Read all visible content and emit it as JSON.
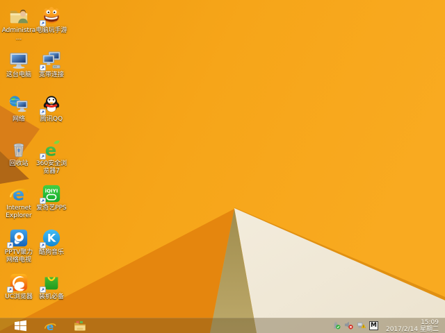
{
  "desktop": {
    "icons": [
      {
        "name": "administrator-folder",
        "label": "Administra...",
        "shortcut": false
      },
      {
        "name": "pc-play-mobile-games",
        "label": "电脑玩手游",
        "shortcut": true
      },
      {
        "name": "this-pc",
        "label": "这台电脑",
        "shortcut": false
      },
      {
        "name": "broadband-connection",
        "label": "宽带连接",
        "shortcut": true
      },
      {
        "name": "network",
        "label": "网络",
        "shortcut": false
      },
      {
        "name": "tencent-qq",
        "label": "腾讯QQ",
        "shortcut": true
      },
      {
        "name": "recycle-bin",
        "label": "回收站",
        "shortcut": false
      },
      {
        "name": "360-safe-browser-7",
        "label": "360安全浏览器7",
        "shortcut": true
      },
      {
        "name": "internet-explorer",
        "label": "Internet Explorer",
        "shortcut": false
      },
      {
        "name": "iqiyi-pps",
        "label": "爱奇艺PPS",
        "shortcut": true
      },
      {
        "name": "pptv-nettv",
        "label": "PPTV聚力 网络电视",
        "shortcut": true
      },
      {
        "name": "kugou-music",
        "label": "酷狗音乐",
        "shortcut": true
      },
      {
        "name": "uc-browser",
        "label": "UC浏览器",
        "shortcut": true
      },
      {
        "name": "essential-software",
        "label": "装机必备",
        "shortcut": true
      }
    ]
  },
  "taskbar": {
    "start": {
      "icon": "windows-flag"
    },
    "pinned": [
      {
        "icon": "internet-explorer"
      },
      {
        "icon": "file-explorer"
      }
    ],
    "tray": {
      "icons": [
        {
          "name": "safely-remove-hardware-ok"
        },
        {
          "name": "volume-muted"
        },
        {
          "name": "network-limited-warning"
        },
        {
          "name": "ime-indicator",
          "label": "M"
        }
      ],
      "clock": {
        "time": "15:09",
        "date": "2017/2/14 星期二"
      }
    }
  },
  "colors": {
    "wallpaper_orange": "#f5a316",
    "wallpaper_orange_dark_facet": "#e5860e",
    "wallpaper_left_facet": "#d97e18",
    "wallpaper_left_facet_dark": "#b06716",
    "wallpaper_cream": "#f0e8d7",
    "wallpaper_tan": "#b3a05e",
    "taskbar_overlay": "rgba(88,70,34,0.34)"
  }
}
